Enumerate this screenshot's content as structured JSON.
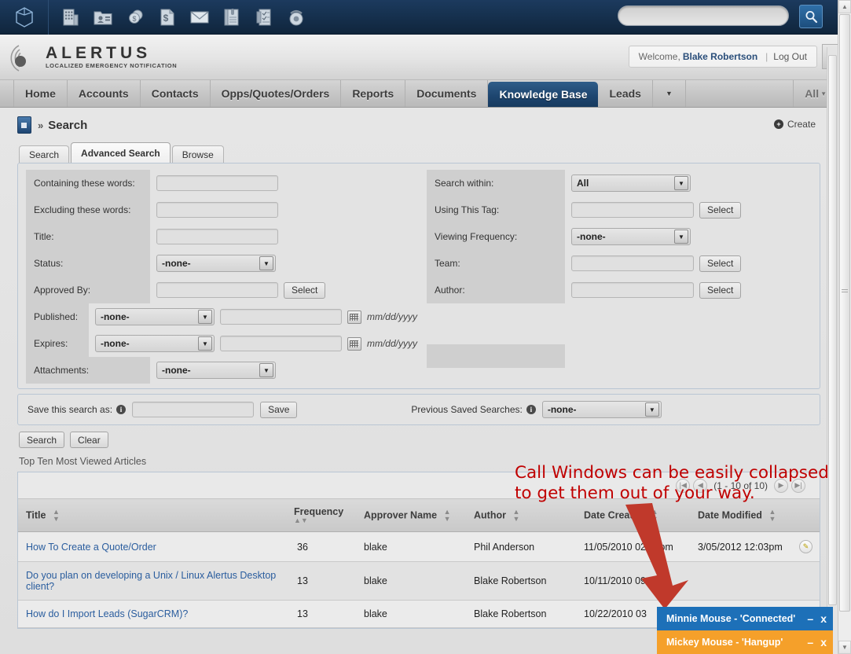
{
  "topbar": {
    "logo_icon": "cube-icon",
    "icons": [
      {
        "name": "building-icon",
        "label": "Accounts"
      },
      {
        "name": "contact-card-icon",
        "label": "Contacts"
      },
      {
        "name": "coins-icon",
        "label": "Opportunities"
      },
      {
        "name": "dollar-document-icon",
        "label": "Quotes"
      },
      {
        "name": "envelope-icon",
        "label": "Emails"
      },
      {
        "name": "notebook-icon",
        "label": "Notes"
      },
      {
        "name": "checklist-icon",
        "label": "Tasks"
      },
      {
        "name": "telephone-icon",
        "label": "Calls"
      }
    ],
    "search_placeholder": "",
    "search_value": "",
    "search_button_icon": "magnifier-icon"
  },
  "header": {
    "brand_name": "ALERTUS",
    "brand_tagline": "LOCALIZED EMERGENCY NOTIFICATION",
    "welcome_prefix": "Welcome,",
    "user_name": "Blake Robertson",
    "separator": "|",
    "logout_label": "Log Out",
    "collapse_icon": "chevron-left-icon"
  },
  "nav": {
    "tabs": [
      {
        "label": "Home",
        "active": false
      },
      {
        "label": "Accounts",
        "active": false
      },
      {
        "label": "Contacts",
        "active": false
      },
      {
        "label": "Opps/Quotes/Orders",
        "active": false
      },
      {
        "label": "Reports",
        "active": false
      },
      {
        "label": "Documents",
        "active": false
      },
      {
        "label": "Knowledge Base",
        "active": true
      },
      {
        "label": "Leads",
        "active": false
      }
    ],
    "more_icon": "chevron-down-icon",
    "all_label": "All"
  },
  "breadcrumb": {
    "module_icon": "knowledge-base-icon",
    "separator": "»",
    "title": "Search",
    "create_label": "Create",
    "create_icon": "plus-circle-icon"
  },
  "search_tabs": [
    {
      "label": "Search",
      "active": false
    },
    {
      "label": "Advanced Search",
      "active": true
    },
    {
      "label": "Browse",
      "active": false
    }
  ],
  "form": {
    "left": [
      {
        "label": "Containing these words:",
        "type": "text",
        "value": ""
      },
      {
        "label": "Excluding these words:",
        "type": "text",
        "value": ""
      },
      {
        "label": "Title:",
        "type": "text",
        "value": ""
      },
      {
        "label": "Status:",
        "type": "select",
        "value": "-none-"
      },
      {
        "label": "Approved By:",
        "type": "text-select",
        "value": "",
        "button": "Select"
      },
      {
        "label": "Published:",
        "type": "select-date",
        "value": "-none-",
        "date_value": "",
        "hint": "mm/dd/yyyy"
      },
      {
        "label": "Expires:",
        "type": "select-date",
        "value": "-none-",
        "date_value": "",
        "hint": "mm/dd/yyyy"
      },
      {
        "label": "Attachments:",
        "type": "select",
        "value": "-none-"
      }
    ],
    "right": [
      {
        "label": "Search within:",
        "type": "select",
        "value": "All"
      },
      {
        "label": "Using This Tag:",
        "type": "text-select",
        "value": "",
        "button": "Select"
      },
      {
        "label": "Viewing Frequency:",
        "type": "select",
        "value": "-none-"
      },
      {
        "label": "Team:",
        "type": "text-select",
        "value": "",
        "button": "Select"
      },
      {
        "label": "Author:",
        "type": "text-select",
        "value": "",
        "button": "Select"
      }
    ]
  },
  "save_row": {
    "save_label": "Save this search as:",
    "save_info_icon": "info-icon",
    "save_input_value": "",
    "save_button": "Save",
    "previous_label": "Previous Saved Searches:",
    "previous_info_icon": "info-icon",
    "previous_value": "-none-"
  },
  "actions": {
    "search_button": "Search",
    "clear_button": "Clear"
  },
  "list": {
    "heading": "Top Ten Most Viewed Articles",
    "pagination": {
      "first_icon": "first-page-icon",
      "prev_icon": "prev-page-icon",
      "range_text": "(1 - 10 of 10)",
      "next_icon": "next-page-icon",
      "last_icon": "last-page-icon"
    },
    "columns": [
      {
        "label": "Title",
        "sortable": true
      },
      {
        "label": "Frequency",
        "sortable": true
      },
      {
        "label": "Approver Name",
        "sortable": true
      },
      {
        "label": "Author",
        "sortable": true
      },
      {
        "label": "Date Created",
        "sortable": true
      },
      {
        "label": "Date Modified",
        "sortable": true
      }
    ],
    "rows": [
      {
        "title": "How To Create a Quote/Order",
        "frequency": "36",
        "approver": "blake",
        "author": "Phil Anderson",
        "created": "11/05/2010 02:23pm",
        "modified": "3/05/2012 12:03pm",
        "edit_icon": "pencil-icon"
      },
      {
        "title": "Do you plan on developing a Unix / Linux Alertus Desktop client?",
        "frequency": "13",
        "approver": "blake",
        "author": "Blake Robertson",
        "created": "10/11/2010 09",
        "modified": "",
        "edit_icon": "pencil-icon"
      },
      {
        "title": "How do I Import Leads (SugarCRM)?",
        "frequency": "13",
        "approver": "blake",
        "author": "Blake Robertson",
        "created": "10/22/2010 03",
        "modified": "",
        "edit_icon": "pencil-icon"
      }
    ]
  },
  "annotation": {
    "text": "Call Windows can be easily collapsed\nto get them out of your way.",
    "color": "#c00000"
  },
  "call_windows": [
    {
      "label": "Minnie Mouse - 'Connected'",
      "status": "Connected",
      "color": "#1d70b8",
      "minimize": "–",
      "close": "x"
    },
    {
      "label": "Mickey Mouse - 'Hangup'",
      "status": "Hangup",
      "color": "#f5a02a",
      "minimize": "–",
      "close": "x"
    }
  ]
}
